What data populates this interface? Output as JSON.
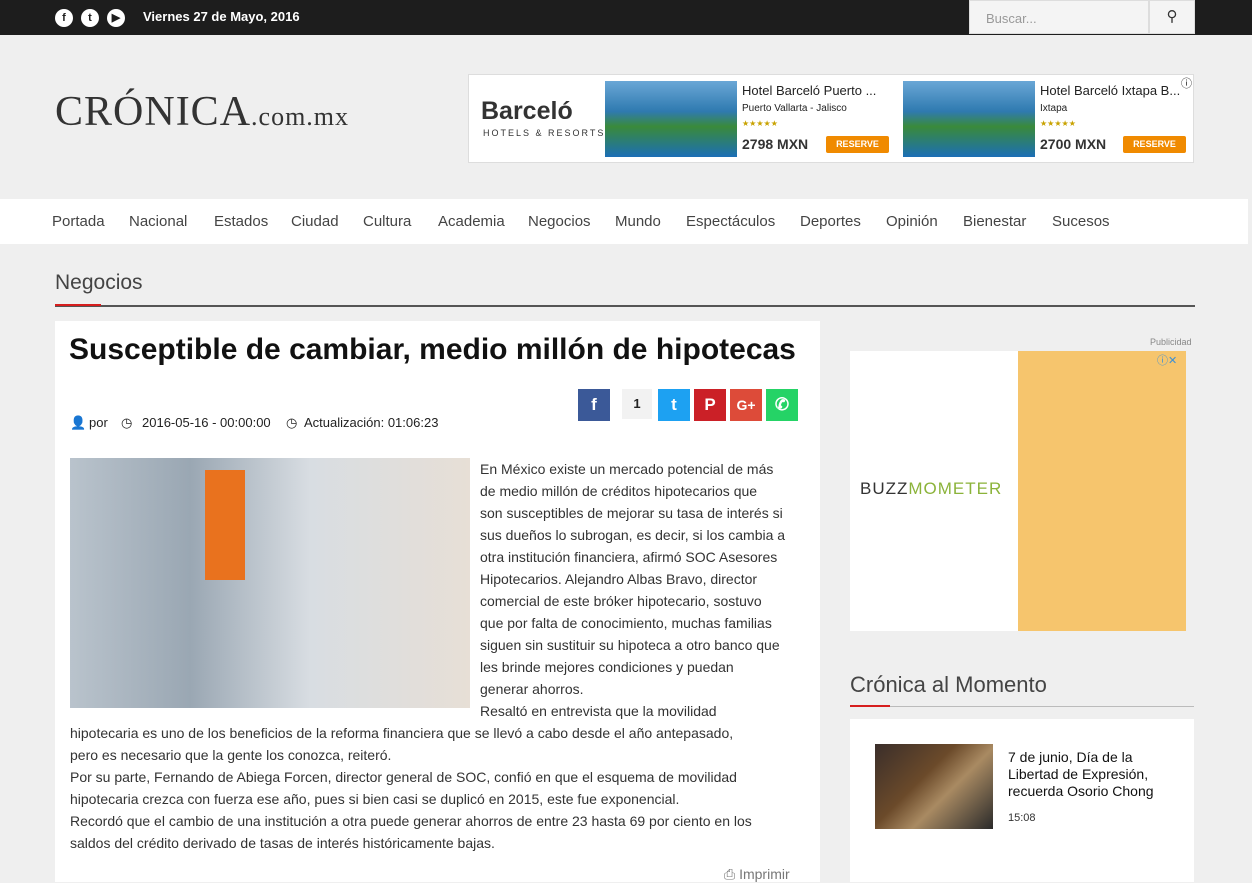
{
  "topbar": {
    "date": "Viernes 27 de Mayo, 2016",
    "search_placeholder": "Buscar...",
    "social": [
      "facebook-icon",
      "twitter-icon",
      "youtube-icon"
    ]
  },
  "logo": {
    "main": "CRÓNICA",
    "suffix": ".com.mx"
  },
  "ad": {
    "brand": "Barceló",
    "brand_sub": "HOTELS & RESORTS",
    "hotels": [
      {
        "name": "Hotel Barceló Puerto ...",
        "location": "Puerto Vallarta - Jalisco",
        "price": "2798 MXN",
        "cta": "RESERVE"
      },
      {
        "name": "Hotel Barceló Ixtapa B...",
        "location": "Ixtapa",
        "price": "2700 MXN",
        "cta": "RESERVE"
      }
    ]
  },
  "nav": [
    "Portada",
    "Nacional",
    "Estados",
    "Ciudad",
    "Cultura",
    "Academia",
    "Negocios",
    "Mundo",
    "Espectáculos",
    "Deportes",
    "Opinión",
    "Bienestar",
    "Sucesos"
  ],
  "section": "Negocios",
  "article": {
    "title": "Susceptible de cambiar, medio millón de hipotecas",
    "author_prefix": "por",
    "date": "2016-05-16 - 00:00:00",
    "updated": "Actualización: 01:06:23",
    "share_count": "1",
    "p_side": [
      "En México existe un mercado potencial de más",
      "de medio millón de créditos hipotecarios que",
      "son susceptibles de mejorar su tasa de interés si",
      "sus dueños lo subrogan, es decir, si los cambia a",
      "otra institución financiera, afirmó SOC Asesores",
      "Hipotecarios. Alejandro Albas Bravo, director",
      "comercial de este bróker hipotecario, sostuvo",
      "que por falta de conocimiento, muchas familias",
      "siguen sin sustituir su hipoteca a otro banco que",
      "les brinde mejores condiciones y puedan",
      "generar ahorros.",
      "Resaltó en entrevista que la movilidad"
    ],
    "p_full": [
      "hipotecaria es uno de los beneficios de la reforma financiera que se llevó a cabo desde el año antepasado,",
      "pero es necesario que la gente los conozca, reiteró.",
      "Por su parte, Fernando de Abiega Forcen, director general de SOC, confió en que el esquema de movilidad",
      "hipotecaria crezca con fuerza ese año, pues si bien casi se duplicó en 2015, este fue exponencial.",
      "Recordó que el cambio de una institución a otra puede generar ahorros de entre 23 hasta 69 por ciento en los",
      "saldos del crédito derivado de tasas de interés históricamente bajas."
    ],
    "print": "Imprimir"
  },
  "sidebar": {
    "ad_label": "Publicidad",
    "ad_brand_a": "BUZZ",
    "ad_brand_b": "MOMETER",
    "momento_title": "Crónica al Momento",
    "news": {
      "title": "7 de junio, Día de la Libertad de Expresión, recuerda Osorio Chong",
      "time": "15:08"
    }
  }
}
